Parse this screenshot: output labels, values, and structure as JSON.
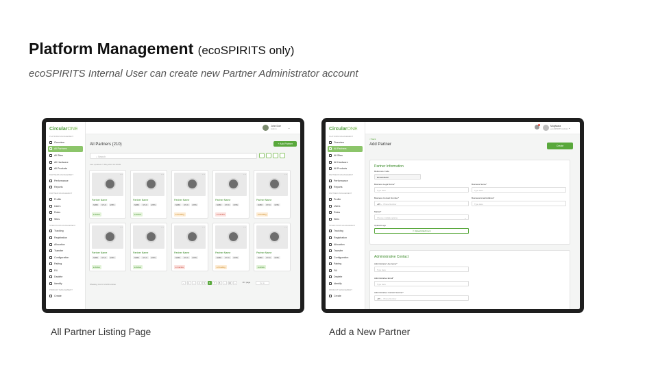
{
  "slide": {
    "title": "Platform Management",
    "title_suffix": "(ecoSPIRITS only)",
    "subtitle": "ecoSPIRITS Internal User can create new Partner Administrator account",
    "left_caption": "All Partner Listing Page",
    "right_caption": "Add a New Partner"
  },
  "brand": {
    "name_a": "Circular",
    "name_b": "ONE"
  },
  "sidebar": {
    "sections": [
      {
        "heading": "PLATFORM MANAGEMENT",
        "items": [
          "Overview",
          "All Partners",
          "All Sites",
          "All Hardware",
          "All Products"
        ]
      },
      {
        "heading": "PARTNERS MANAGEMENT",
        "items": [
          "Performance",
          "Reports"
        ]
      },
      {
        "heading": "PARTNER MANAGEMENT",
        "items": [
          "Profile",
          "Users",
          "Roles",
          "Sites"
        ]
      },
      {
        "heading": "OPERATIONS MANAGEMENT",
        "items": [
          "Tracking",
          "Registration",
          "Allocation",
          "Transfer",
          "Configuration",
          "Pairing",
          "Fill",
          "Deplete",
          "Identify"
        ]
      },
      {
        "heading": "PRODUCT MANAGEMENT",
        "items": [
          "Create"
        ]
      }
    ],
    "active_item": "All Partners"
  },
  "listing": {
    "user_name": "John Doe",
    "user_role": "Admin",
    "page_title": "All Partners (210)",
    "add_button": "+ Add Partner",
    "search_placeholder": "Search",
    "last_updated": "Last updated 27 May 2024 10:00AM",
    "cards": [
      {
        "name": "Partner Name",
        "tags": [
          "SMBR",
          "NTUC",
          "EHBV"
        ],
        "status": "Active"
      },
      {
        "name": "Partner Name",
        "tags": [
          "SMBR",
          "NTUC",
          "EHBV"
        ],
        "status": "Active"
      },
      {
        "name": "Partner Name",
        "tags": [
          "SMBR",
          "NTUC",
          "EHBV"
        ],
        "status": "Pending"
      },
      {
        "name": "Partner Name",
        "tags": [
          "SMBR",
          "NTUC",
          "EHBV"
        ],
        "status": "Inactive"
      },
      {
        "name": "Partner Name",
        "tags": [
          "SMBR",
          "NTUC",
          "EHBV"
        ],
        "status": "Pending"
      },
      {
        "name": "Partner Name",
        "tags": [
          "SMBR",
          "NTUC",
          "EHBV"
        ],
        "status": "Active"
      },
      {
        "name": "Partner Name",
        "tags": [
          "SMBR",
          "NTUC",
          "EHBV"
        ],
        "status": "Active"
      },
      {
        "name": "Partner Name",
        "tags": [
          "SMBR",
          "NTUC",
          "EHBV"
        ],
        "status": "Inactive"
      },
      {
        "name": "Partner Name",
        "tags": [
          "SMBR",
          "NTUC",
          "EHBV"
        ],
        "status": "Pending"
      },
      {
        "name": "Partner Name",
        "tags": [
          "SMBR",
          "NTUC",
          "EHBV"
        ],
        "status": "Active"
      }
    ],
    "showing_text": "Showing 1 to 10 of 210 entries",
    "pager": [
      "‹",
      "1",
      "...",
      "4",
      "5",
      "6",
      "7",
      "8",
      "...",
      "10",
      "›"
    ],
    "pager_current": "6",
    "per_page": "10 / page",
    "goto": "Go to"
  },
  "form": {
    "user_name": "Mugiwara",
    "user_role": "ecoSPIRITS Admin",
    "back_label": "< Back",
    "page_title": "Add Partner",
    "create_button": "Create",
    "partner_info": {
      "title": "Partner Information",
      "reference_label": "Reference Code",
      "reference_value": "BCN234523P",
      "legal_name_label": "Business Legal Name*",
      "legal_name_placeholder": "Type Here",
      "business_name_label": "Business Name*",
      "business_name_placeholder": "Type Here",
      "contact_label": "Business Contact Number*",
      "contact_code": "+65",
      "contact_placeholder": "Phone Number",
      "email_label": "Business Email Address*",
      "email_placeholder": "Type Here",
      "market_label": "Market*",
      "market_placeholder": "Choose multiple options",
      "logo_label": "Upload Logo",
      "upload_button": "Upload Attachment"
    },
    "admin_contact": {
      "title": "Administrative Contact",
      "username_label": "Administrator Username*",
      "username_placeholder": "Type Here",
      "email_label": "Administrative Email*",
      "email_placeholder": "Type Here",
      "contact_label": "Administrative Contact Number*",
      "contact_code": "+65",
      "contact_placeholder": "Phone Number"
    }
  },
  "colors": {
    "brand_green": "#59a83c",
    "active_nav": "#8cc56a",
    "status_active": "#3a8a28",
    "status_pending": "#c7821a",
    "status_inactive": "#c9483c"
  }
}
